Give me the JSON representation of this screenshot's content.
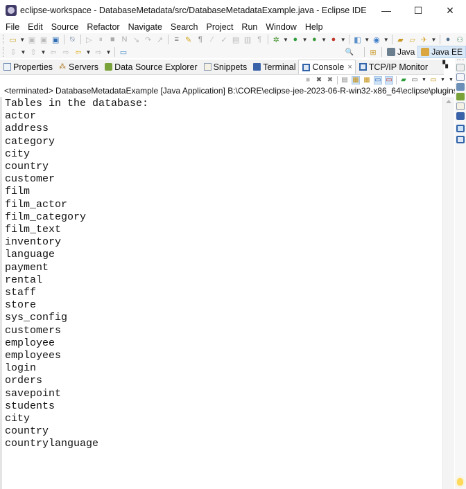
{
  "window": {
    "title": "eclipse-workspace - DatabaseMetadata/src/DatabaseMetadataExample.java - Eclipse IDE",
    "minimize_label": "—",
    "maximize_label": "☐",
    "close_label": "✕"
  },
  "menu": {
    "items": [
      "File",
      "Edit",
      "Source",
      "Refactor",
      "Navigate",
      "Search",
      "Project",
      "Run",
      "Window",
      "Help"
    ]
  },
  "toolbar": {
    "row1_icons": [
      "new-icon",
      "save-icon",
      "save-all-icon",
      "terminal-icon",
      "skip-breakpoints-icon",
      "resume-icon",
      "suspend-icon",
      "terminate-icon",
      "disconnect-icon",
      "step-into-icon",
      "step-over-icon",
      "step-return-icon",
      "toggle-mark-occurrences-icon",
      "toggle-block-selection-icon",
      "show-whitespace-icon",
      "debug-icon",
      "run-icon",
      "coverage-icon",
      "external-tools-icon",
      "new-server-icon",
      "new-web-service-icon",
      "open-type-icon",
      "open-task-icon",
      "search-icon",
      "globe-icon",
      "persp-icon"
    ],
    "row2_icons": [
      "next-annotation-icon",
      "previous-annotation-icon",
      "last-edit-icon",
      "back-icon",
      "forward-icon",
      "pin-editor-icon"
    ],
    "search_icon": "🔍",
    "perspectives": [
      {
        "label": "Java",
        "active": false
      },
      {
        "label": "Java EE",
        "active": true
      }
    ]
  },
  "view_tabs": [
    {
      "label": "Properties",
      "icon": "properties-icon",
      "active": false
    },
    {
      "label": "Servers",
      "icon": "servers-icon",
      "active": false
    },
    {
      "label": "Data Source Explorer",
      "icon": "data-source-icon",
      "active": false
    },
    {
      "label": "Snippets",
      "icon": "snippets-icon",
      "active": false
    },
    {
      "label": "Terminal",
      "icon": "terminal-icon",
      "active": false
    },
    {
      "label": "Console",
      "icon": "console-icon",
      "active": true,
      "close": "×"
    },
    {
      "label": "TCP/IP Monitor",
      "icon": "tcpip-monitor-icon",
      "active": false
    }
  ],
  "console": {
    "status": "<terminated> DatabaseMetadataExample [Java Application] B:\\CORE\\eclipse-jee-2023-06-R-win32-x86_64\\eclipse\\plugins\\",
    "output_lines": [
      "Tables in the database:",
      "actor",
      "address",
      "category",
      "city",
      "country",
      "customer",
      "film",
      "film_actor",
      "film_category",
      "film_text",
      "inventory",
      "language",
      "payment",
      "rental",
      "staff",
      "store",
      "sys_config",
      "customers",
      "employee",
      "employees",
      "login",
      "orders",
      "savepoint",
      "students",
      "city",
      "country",
      "countrylanguage"
    ]
  },
  "colors": {
    "active_perspective_bg": "#d9e8f7",
    "toggle_on_bg": "#cfe3f6"
  }
}
